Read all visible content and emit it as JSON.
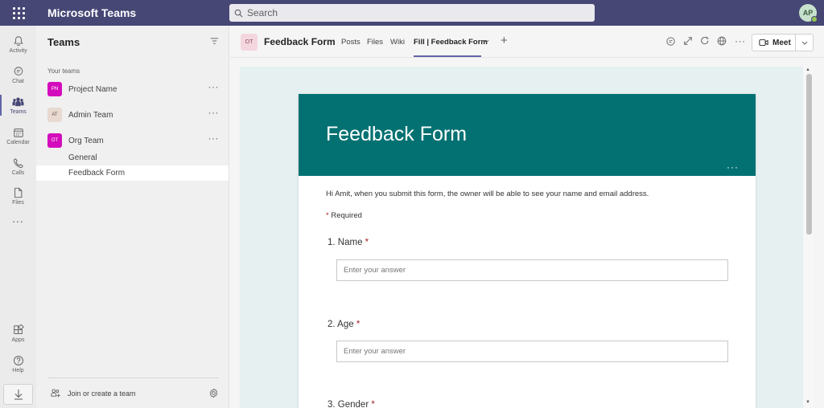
{
  "app": {
    "title": "Microsoft Teams"
  },
  "search": {
    "placeholder": "Search"
  },
  "user": {
    "initials": "AP"
  },
  "appbar": {
    "items": [
      {
        "label": "Activity"
      },
      {
        "label": "Chat"
      },
      {
        "label": "Teams"
      },
      {
        "label": "Calendar"
      },
      {
        "label": "Calls"
      },
      {
        "label": "Files"
      }
    ],
    "more": "...",
    "bottom": [
      {
        "label": "Apps"
      },
      {
        "label": "Help"
      }
    ]
  },
  "teams_pane": {
    "title": "Teams",
    "section": "Your teams",
    "teams": [
      {
        "initials": "PN",
        "name": "Project Name",
        "color": "#d40dbc"
      },
      {
        "initials": "AT",
        "name": "Admin Team",
        "color": "#e8d9d1"
      },
      {
        "initials": "OT",
        "name": "Org Team",
        "color": "#d40dbc"
      }
    ],
    "channels": [
      {
        "name": "General"
      },
      {
        "name": "Feedback Form"
      }
    ],
    "join": "Join or create a team"
  },
  "channel_header": {
    "badge": "OT",
    "title": "Feedback Form",
    "tabs": [
      {
        "label": "Posts"
      },
      {
        "label": "Files"
      },
      {
        "label": "Wiki"
      },
      {
        "label": "Fill | Feedback Form"
      }
    ],
    "add": "+",
    "meet": "Meet"
  },
  "form": {
    "title": "Feedback Form",
    "intro": "Hi Amit, when you submit this form, the owner will be able to see your name and email address.",
    "required_label": "Required",
    "questions": [
      {
        "label": "1. Name",
        "placeholder": "Enter your answer"
      },
      {
        "label": "2. Age",
        "placeholder": "Enter your answer"
      },
      {
        "label": "3. Gender"
      }
    ]
  },
  "colors": {
    "topbar": "#464775",
    "accent": "#6264a7",
    "form_banner": "#037172",
    "required": "#a4262c"
  }
}
